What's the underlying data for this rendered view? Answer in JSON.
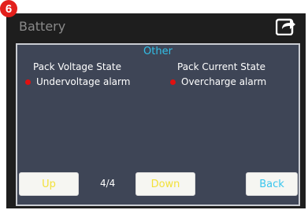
{
  "badge": {
    "number": "6"
  },
  "header": {
    "title": "Battery"
  },
  "section": {
    "title": "Other"
  },
  "pack_voltage": {
    "label": "Pack Voltage State",
    "alarm": "Undervoltage alarm"
  },
  "pack_current": {
    "label": "Pack Current State",
    "alarm": "Overcharge alarm"
  },
  "footer": {
    "up_label": "Up",
    "page_indicator": "4/4",
    "down_label": "Down",
    "back_label": "Back"
  },
  "colors": {
    "screen_bg": "#1e1e1e",
    "panel_bg": "#3e4556",
    "section_title": "#32c0e8",
    "alarm_dot": "#e01010",
    "nav_text_yellow": "#f2e13a",
    "back_text_blue": "#38c6ee",
    "badge_bg": "#e3201c"
  },
  "icons": {
    "share": "share-arrow-icon",
    "alarm": "red-dot-icon"
  }
}
